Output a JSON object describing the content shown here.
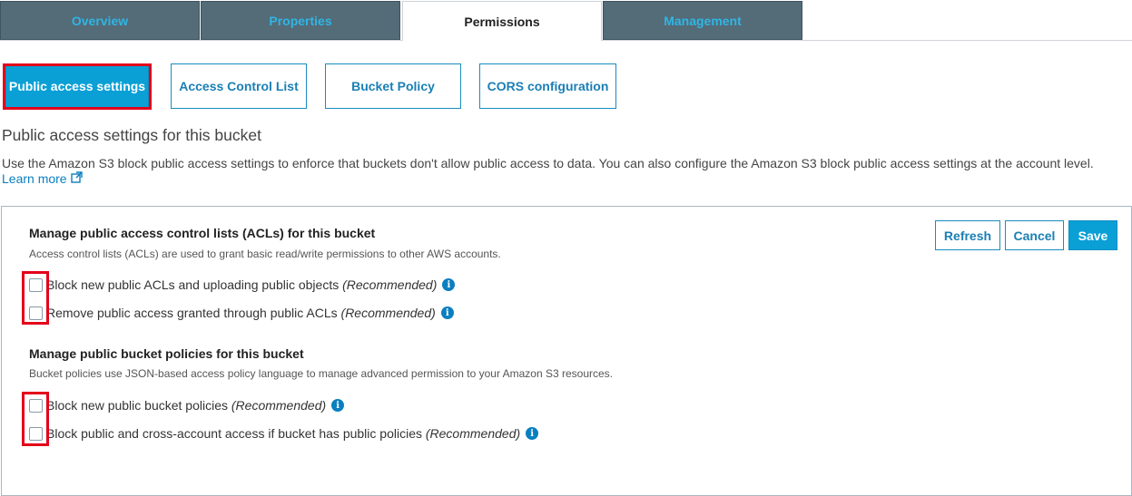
{
  "tabs": [
    {
      "label": "Overview"
    },
    {
      "label": "Properties"
    },
    {
      "label": "Permissions",
      "active": true
    },
    {
      "label": "Management"
    }
  ],
  "subnav": [
    {
      "label": "Public access settings",
      "active": true
    },
    {
      "label": "Access Control List"
    },
    {
      "label": "Bucket Policy"
    },
    {
      "label": "CORS configuration"
    }
  ],
  "section": {
    "title": "Public access settings for this bucket",
    "description": "Use the Amazon S3 block public access settings to enforce that buckets don't allow public access to data. You can also configure the Amazon S3 block public access settings at the account level.",
    "learn_more": "Learn more"
  },
  "actions": {
    "refresh": "Refresh",
    "cancel": "Cancel",
    "save": "Save"
  },
  "acl_group": {
    "title": "Manage public access control lists (ACLs) for this bucket",
    "description": "Access control lists (ACLs) are used to grant basic read/write permissions to other AWS accounts.",
    "options": [
      {
        "label": "Block new public ACLs and uploading public objects",
        "note": "(Recommended)",
        "checked": false
      },
      {
        "label": "Remove public access granted through public ACLs",
        "note": "(Recommended)",
        "checked": false
      }
    ]
  },
  "policy_group": {
    "title": "Manage public bucket policies for this bucket",
    "description": "Bucket policies use JSON-based access policy language to manage advanced permission to your Amazon S3 resources.",
    "options": [
      {
        "label": "Block new public bucket policies",
        "note": "(Recommended)",
        "checked": false
      },
      {
        "label": "Block public and cross-account access if bucket has public policies",
        "note": "(Recommended)",
        "checked": false
      }
    ]
  },
  "icons": {
    "info": "info-icon",
    "external_link": "external-link-icon"
  },
  "colors": {
    "tab_bg": "#546b78",
    "tab_text": "#2fb6e4",
    "accent": "#0aa0d6",
    "link": "#0a7fc0",
    "highlight": "#e3001b"
  }
}
